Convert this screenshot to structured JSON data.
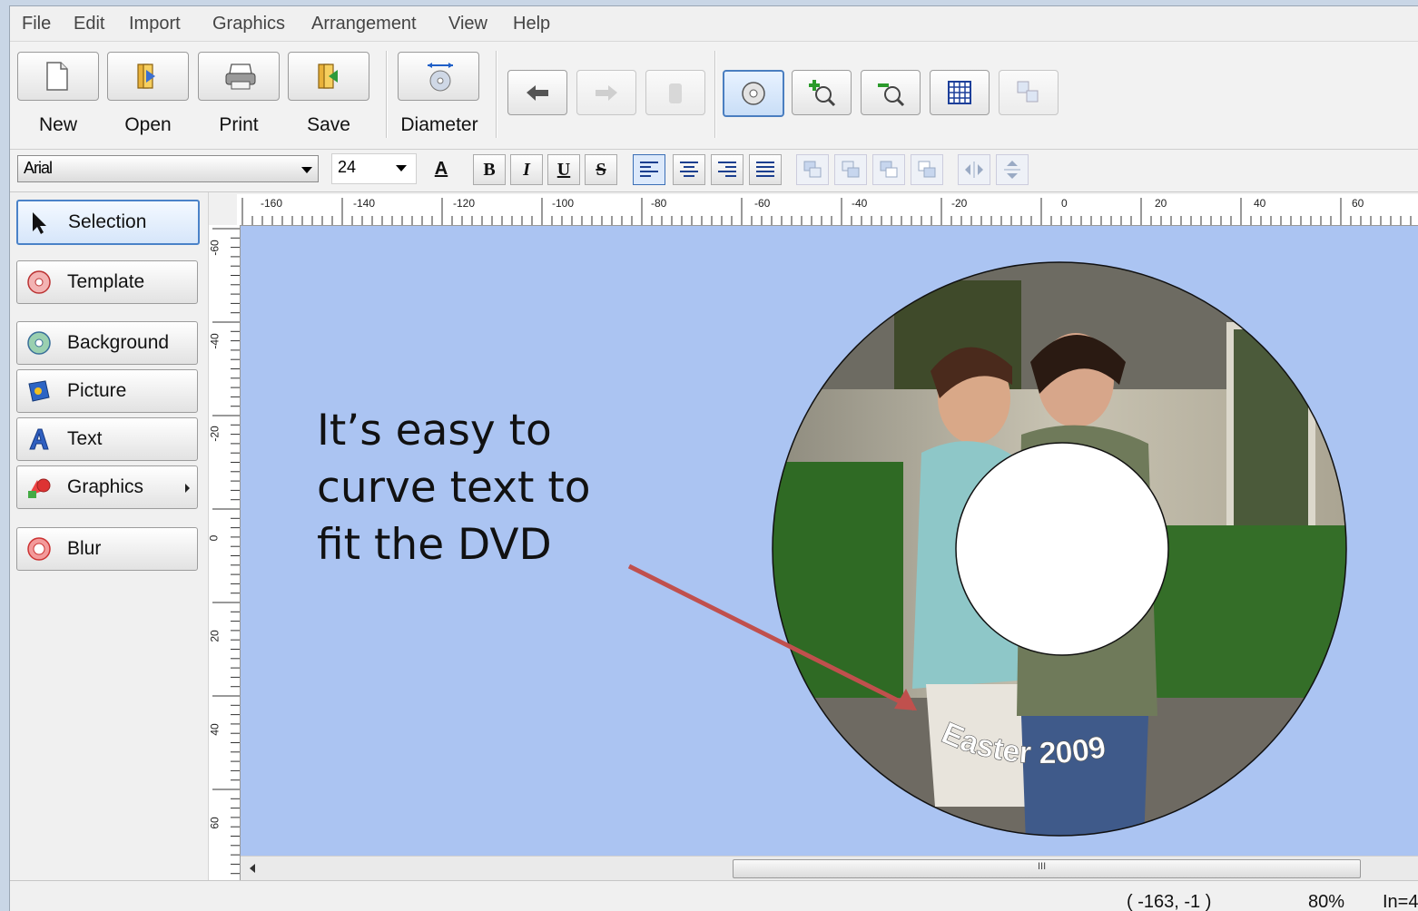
{
  "menu": [
    "File",
    "Edit",
    "Import",
    "Graphics",
    "Arrangement",
    "View",
    "Help"
  ],
  "toolbar": {
    "new": "New",
    "open": "Open",
    "print": "Print",
    "save": "Save",
    "diameter": "Diameter"
  },
  "format": {
    "font": "Arial",
    "size": "24",
    "bold": "B",
    "italic": "I",
    "underline": "U",
    "strike": "S"
  },
  "sidebar": {
    "items": [
      {
        "label": "Selection"
      },
      {
        "label": "Template"
      },
      {
        "label": "Background"
      },
      {
        "label": "Picture"
      },
      {
        "label": "Text"
      },
      {
        "label": "Graphics"
      },
      {
        "label": "Blur"
      }
    ]
  },
  "ruler": {
    "h_labels": [
      "-160",
      "-140",
      "-120",
      "-100",
      "-80",
      "-60",
      "-40",
      "-20",
      "0",
      "20",
      "40",
      "60"
    ],
    "v_labels": [
      "-60",
      "-40",
      "-20",
      "0",
      "20",
      "40",
      "60"
    ]
  },
  "canvas": {
    "note": [
      "It’s easy to",
      "curve text to",
      "fit the DVD"
    ],
    "disc_text": "Easter 2009"
  },
  "scrollbar": {
    "grip": "III"
  },
  "status": {
    "coords": "( -163,  -1 )",
    "zoom": "80%",
    "extra": "In=4"
  },
  "colors": {
    "canvas": "#abc4f2",
    "arrow": "#c0504d",
    "active_border": "#4a82c8"
  }
}
